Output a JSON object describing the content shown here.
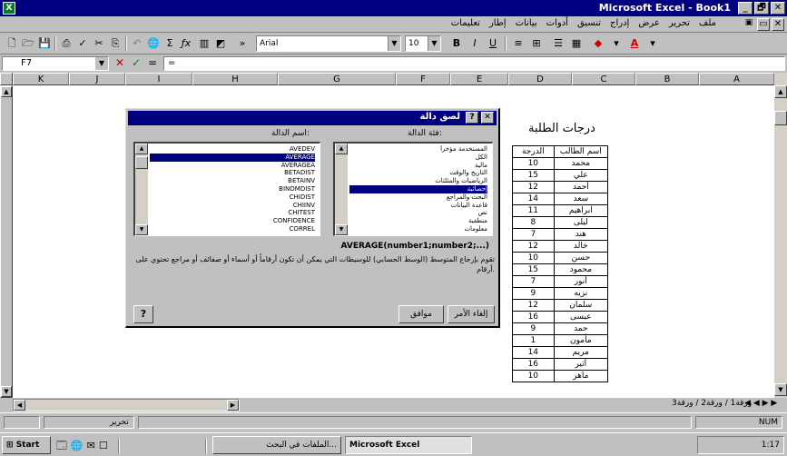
{
  "window": {
    "title": "Microsoft Excel - Book1",
    "minimize": "_",
    "restore": "🗗",
    "close": "✕"
  },
  "menu": {
    "items": [
      "ملف",
      "تحرير",
      "عرض",
      "إدراج",
      "تنسيق",
      "أدوات",
      "بيانات",
      "إطار",
      "تعليمات"
    ]
  },
  "toolbar": {
    "font_name": "Arial",
    "font_size": "10",
    "bold": "B",
    "italic": "I",
    "underline": "U",
    "font_color_letter": "A"
  },
  "formula_bar": {
    "name_box": "F7",
    "cancel": "✕",
    "enter": "✓",
    "equals": "=",
    "content": "="
  },
  "columns": [
    "K",
    "J",
    "I",
    "H",
    "G",
    "F",
    "E",
    "D",
    "C",
    "B",
    "A"
  ],
  "sheet": {
    "title": "درجات الطلبة",
    "header_name": "اسم الطالب",
    "header_grade": "الدرجة",
    "students": [
      {
        "name": "محمد",
        "grade": "10"
      },
      {
        "name": "علي",
        "grade": "15"
      },
      {
        "name": "أحمد",
        "grade": "12"
      },
      {
        "name": "سعد",
        "grade": "14"
      },
      {
        "name": "ابراهيم",
        "grade": "11"
      },
      {
        "name": "ليلى",
        "grade": "8"
      },
      {
        "name": "هند",
        "grade": "7"
      },
      {
        "name": "خالد",
        "grade": "12"
      },
      {
        "name": "حسن",
        "grade": "10"
      },
      {
        "name": "محمود",
        "grade": "15"
      },
      {
        "name": "أنور",
        "grade": "7"
      },
      {
        "name": "نزيه",
        "grade": "9"
      },
      {
        "name": "سلمان",
        "grade": "12"
      },
      {
        "name": "عيسى",
        "grade": "16"
      },
      {
        "name": "حمد",
        "grade": "9"
      },
      {
        "name": "مأمون",
        "grade": "1"
      },
      {
        "name": "مريم",
        "grade": "14"
      },
      {
        "name": "أثير",
        "grade": "16"
      },
      {
        "name": "ماهر",
        "grade": "10"
      }
    ]
  },
  "dialog": {
    "title": "لصق دالة",
    "category_label": "فئة الدالة:",
    "function_label": "اسم الدالة:",
    "categories": [
      "المستخدمة مؤخراً",
      "الكل",
      "مالية",
      "التاريخ والوقت",
      "الرياضيات والمثلثات",
      "إحصائية",
      "البحث والمراجع",
      "قاعدة البيانات",
      "نص",
      "منطقية",
      "معلومات"
    ],
    "selected_category_index": 5,
    "functions": [
      "AVEDEV",
      "AVERAGE",
      "AVERAGEA",
      "BETADIST",
      "BETAINV",
      "BINOMDIST",
      "CHIDIST",
      "CHIINV",
      "CHITEST",
      "CONFIDENCE",
      "CORREL"
    ],
    "selected_function_index": 1,
    "syntax": "AVERAGE(number1;number2;...)",
    "description": "تقوم بإرجاع المتوسط (الوسط الحسابي) للوسيطات التي يمكن أن تكون أرقاماً أو أسماء أو صفائف أو مراجع تحتوي على أرقام.",
    "ok": "موافق",
    "cancel": "إلغاء الأمر",
    "help": "?",
    "close": "✕"
  },
  "tabs": {
    "sheets": [
      "Sheet1",
      "Sheet2",
      "Sheet3"
    ],
    "label": "ورقة1 / ورقة2 / ورقة3"
  },
  "status": {
    "mode": "تحرير",
    "right": "NUM"
  },
  "taskbar": {
    "start": "Start",
    "clock": "1:17",
    "items": [
      "الملفات في البحث...",
      "Microsoft Excel"
    ]
  }
}
